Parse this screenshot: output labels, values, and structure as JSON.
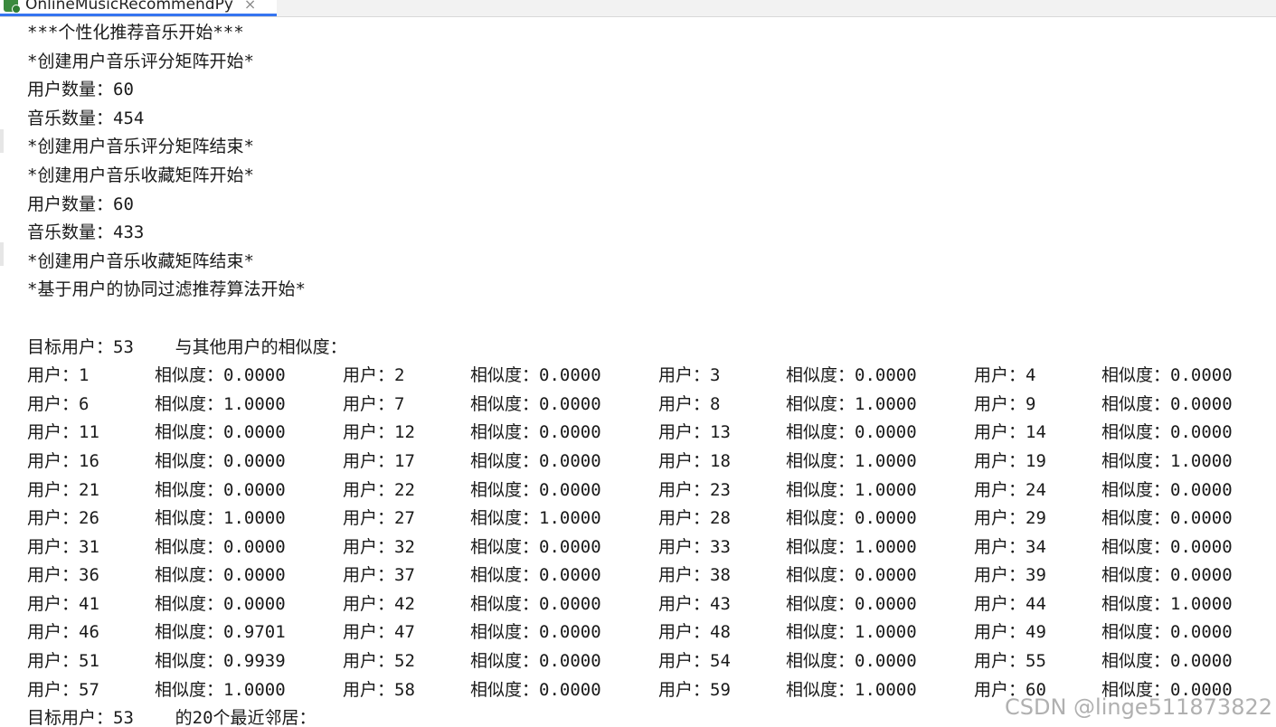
{
  "tab": {
    "title": "OnlineMusicRecommendPy",
    "close": "×",
    "icon": "python-file-icon"
  },
  "lines_top": [
    "***个性化推荐音乐开始***",
    "*创建用户音乐评分矩阵开始*",
    "用户数量：60",
    "音乐数量：454",
    "*创建用户音乐评分矩阵结束*",
    "*创建用户音乐收藏矩阵开始*",
    "用户数量：60",
    "音乐数量：433",
    "*创建用户音乐收藏矩阵结束*",
    "*基于用户的协同过滤推荐算法开始*",
    "",
    "目标用户：53    与其他用户的相似度："
  ],
  "similarity_rows": [
    [
      {
        "user": "用户：1",
        "sim": "相似度：0.0000"
      },
      {
        "user": "用户：2",
        "sim": "相似度：0.0000"
      },
      {
        "user": "用户：3",
        "sim": "相似度：0.0000"
      },
      {
        "user": "用户：4",
        "sim": "相似度：0.0000"
      }
    ],
    [
      {
        "user": "用户：6",
        "sim": "相似度：1.0000"
      },
      {
        "user": "用户：7",
        "sim": "相似度：0.0000"
      },
      {
        "user": "用户：8",
        "sim": "相似度：1.0000"
      },
      {
        "user": "用户：9",
        "sim": "相似度：0.0000"
      }
    ],
    [
      {
        "user": "用户：11",
        "sim": "相似度：0.0000"
      },
      {
        "user": "用户：12",
        "sim": "相似度：0.0000"
      },
      {
        "user": "用户：13",
        "sim": "相似度：0.0000"
      },
      {
        "user": "用户：14",
        "sim": "相似度：0.0000"
      }
    ],
    [
      {
        "user": "用户：16",
        "sim": "相似度：0.0000"
      },
      {
        "user": "用户：17",
        "sim": "相似度：0.0000"
      },
      {
        "user": "用户：18",
        "sim": "相似度：1.0000"
      },
      {
        "user": "用户：19",
        "sim": "相似度：1.0000"
      }
    ],
    [
      {
        "user": "用户：21",
        "sim": "相似度：0.0000"
      },
      {
        "user": "用户：22",
        "sim": "相似度：0.0000"
      },
      {
        "user": "用户：23",
        "sim": "相似度：1.0000"
      },
      {
        "user": "用户：24",
        "sim": "相似度：0.0000"
      }
    ],
    [
      {
        "user": "用户：26",
        "sim": "相似度：1.0000"
      },
      {
        "user": "用户：27",
        "sim": "相似度：1.0000"
      },
      {
        "user": "用户：28",
        "sim": "相似度：0.0000"
      },
      {
        "user": "用户：29",
        "sim": "相似度：0.0000"
      }
    ],
    [
      {
        "user": "用户：31",
        "sim": "相似度：0.0000"
      },
      {
        "user": "用户：32",
        "sim": "相似度：0.0000"
      },
      {
        "user": "用户：33",
        "sim": "相似度：1.0000"
      },
      {
        "user": "用户：34",
        "sim": "相似度：0.0000"
      }
    ],
    [
      {
        "user": "用户：36",
        "sim": "相似度：0.0000"
      },
      {
        "user": "用户：37",
        "sim": "相似度：0.0000"
      },
      {
        "user": "用户：38",
        "sim": "相似度：0.0000"
      },
      {
        "user": "用户：39",
        "sim": "相似度：0.0000"
      }
    ],
    [
      {
        "user": "用户：41",
        "sim": "相似度：0.0000"
      },
      {
        "user": "用户：42",
        "sim": "相似度：0.0000"
      },
      {
        "user": "用户：43",
        "sim": "相似度：0.0000"
      },
      {
        "user": "用户：44",
        "sim": "相似度：1.0000"
      }
    ],
    [
      {
        "user": "用户：46",
        "sim": "相似度：0.9701"
      },
      {
        "user": "用户：47",
        "sim": "相似度：0.0000"
      },
      {
        "user": "用户：48",
        "sim": "相似度：1.0000"
      },
      {
        "user": "用户：49",
        "sim": "相似度：0.0000"
      }
    ],
    [
      {
        "user": "用户：51",
        "sim": "相似度：0.9939"
      },
      {
        "user": "用户：52",
        "sim": "相似度：0.0000"
      },
      {
        "user": "用户：54",
        "sim": "相似度：0.0000"
      },
      {
        "user": "用户：55",
        "sim": "相似度：0.0000"
      }
    ],
    [
      {
        "user": "用户：57",
        "sim": "相似度：1.0000"
      },
      {
        "user": "用户：58",
        "sim": "相似度：0.0000"
      },
      {
        "user": "用户：59",
        "sim": "相似度：1.0000"
      },
      {
        "user": "用户：60",
        "sim": "相似度：0.0000"
      }
    ]
  ],
  "last_line": "目标用户：53    的20个最近邻居：",
  "watermark": "CSDN @linge511873822"
}
